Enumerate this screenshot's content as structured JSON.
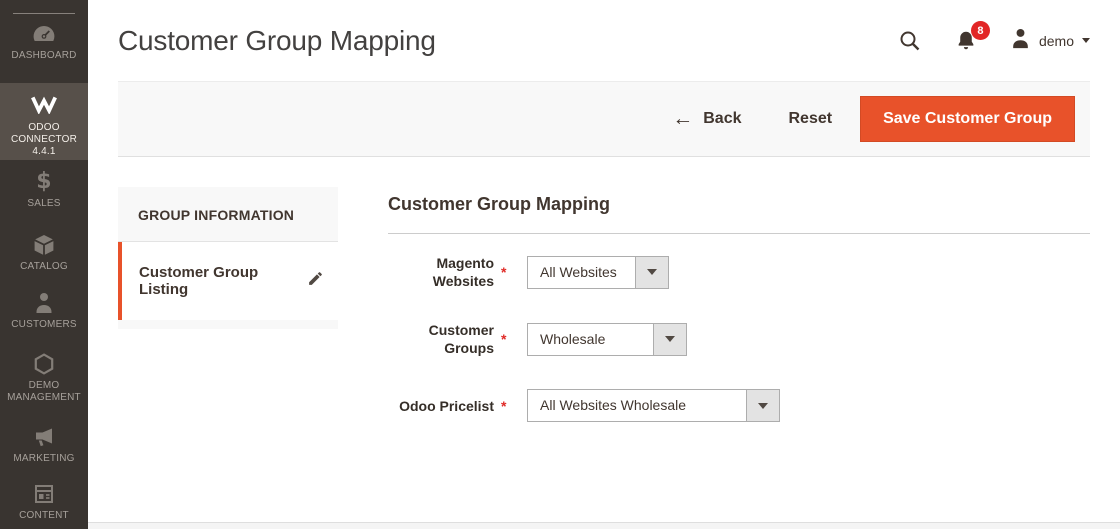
{
  "colors": {
    "accent_orange": "#e8522a",
    "sidebar_bg": "#393430",
    "sidebar_active_bg": "#57504a",
    "badge_red": "#e22626",
    "required_red": "#e02b27"
  },
  "icons": {
    "sales_glyph": "$",
    "back_arrow": "←"
  },
  "sidebar": {
    "items": [
      {
        "label": "DASHBOARD",
        "icon": "dashboard-icon",
        "active": false
      },
      {
        "label": "ODOO CONNECTOR 4.4.1",
        "icon": "odoo-connector-icon",
        "active": true
      },
      {
        "label": "SALES",
        "icon": "sales-icon",
        "active": false
      },
      {
        "label": "CATALOG",
        "icon": "catalog-icon",
        "active": false
      },
      {
        "label": "CUSTOMERS",
        "icon": "customers-icon",
        "active": false
      },
      {
        "label": "DEMO MANAGEMENT",
        "icon": "demo-management-icon",
        "active": false
      },
      {
        "label": "MARKETING",
        "icon": "marketing-icon",
        "active": false
      },
      {
        "label": "CONTENT",
        "icon": "content-icon",
        "active": false
      }
    ]
  },
  "header": {
    "title": "Customer Group Mapping",
    "notification_count": "8",
    "username": "demo"
  },
  "toolbar": {
    "back_label": "Back",
    "reset_label": "Reset",
    "save_label": "Save Customer Group"
  },
  "panel": {
    "header": "GROUP INFORMATION",
    "items": [
      {
        "label": "Customer Group Listing"
      }
    ]
  },
  "form": {
    "section_title": "Customer Group Mapping",
    "fields": [
      {
        "label": "Magento Websites",
        "required": "*",
        "value": "All Websites"
      },
      {
        "label": "Customer Groups",
        "required": "*",
        "value": "Wholesale"
      },
      {
        "label": "Odoo Pricelist",
        "required": "*",
        "value": "All Websites Wholesale"
      }
    ]
  }
}
